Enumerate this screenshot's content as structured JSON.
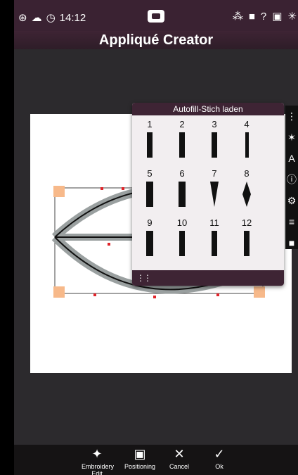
{
  "status": {
    "time": "14:12",
    "icons": [
      "wifi-icon",
      "cloud-icon",
      "clock-icon",
      "usb-icon",
      "bluetooth-icon",
      "book-icon",
      "help-icon",
      "save-icon",
      "settings-icon"
    ]
  },
  "app": {
    "title": "Appliqué Creator"
  },
  "popup": {
    "title": "Autofill-Stich laden",
    "stitches": [
      "1",
      "2",
      "3",
      "4",
      "5",
      "6",
      "7",
      "8",
      "9",
      "10",
      "11",
      "12"
    ]
  },
  "toolbar": {
    "embroidery_edit": "Embroidery Edit",
    "positioning": "Positioning",
    "cancel": "Cancel",
    "ok": "Ok"
  },
  "colors": {
    "accent": "#3e2434",
    "handle": "#f7b98a",
    "marker": "#e0242a"
  }
}
